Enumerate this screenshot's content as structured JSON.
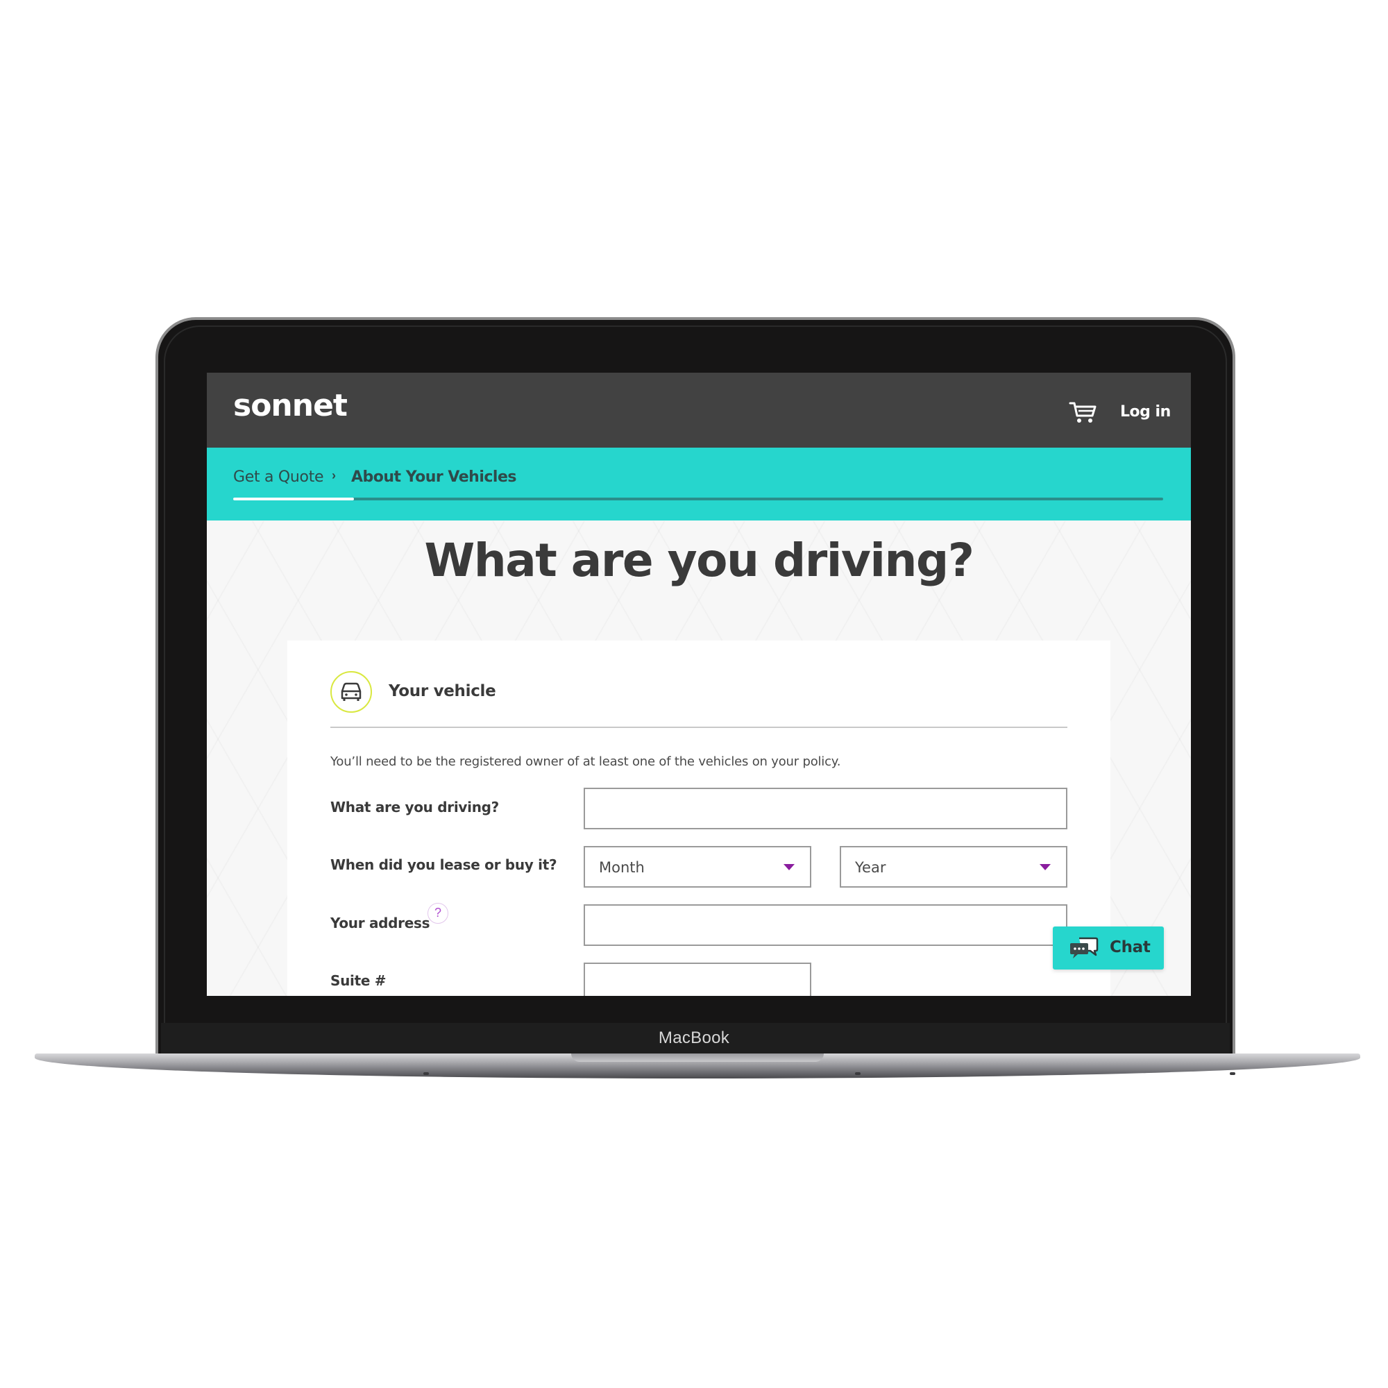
{
  "device": {
    "label": "MacBook"
  },
  "header": {
    "logo": "sonnet",
    "cart_icon": "cart-icon",
    "login_label": "Log in"
  },
  "breadcrumb": {
    "step1": "Get a Quote",
    "separator_icon": "chevron-right-icon",
    "step2": "About Your Vehicles",
    "progress_fraction": 0.13
  },
  "page": {
    "title": "What are you driving?"
  },
  "form": {
    "section_icon": "car-icon",
    "section_title": "Your vehicle",
    "note": "You’ll need to be the registered owner of at least one of the vehicles on your policy.",
    "vehicle_label": "What are you driving?",
    "vehicle_value": "",
    "purchase_label": "When did you lease or buy it?",
    "month_selected": "Month",
    "year_selected": "Year",
    "address_label": "Your address",
    "address_help_icon": "?",
    "address_value": "",
    "suite_label": "Suite #",
    "suite_value": ""
  },
  "chat": {
    "icon": "chat-bubbles-icon",
    "label": "Chat"
  },
  "colors": {
    "header_bg": "#424242",
    "accent_teal": "#26d6cd",
    "caret_purple": "#8a1d9e",
    "icon_ring": "#d9e840"
  }
}
